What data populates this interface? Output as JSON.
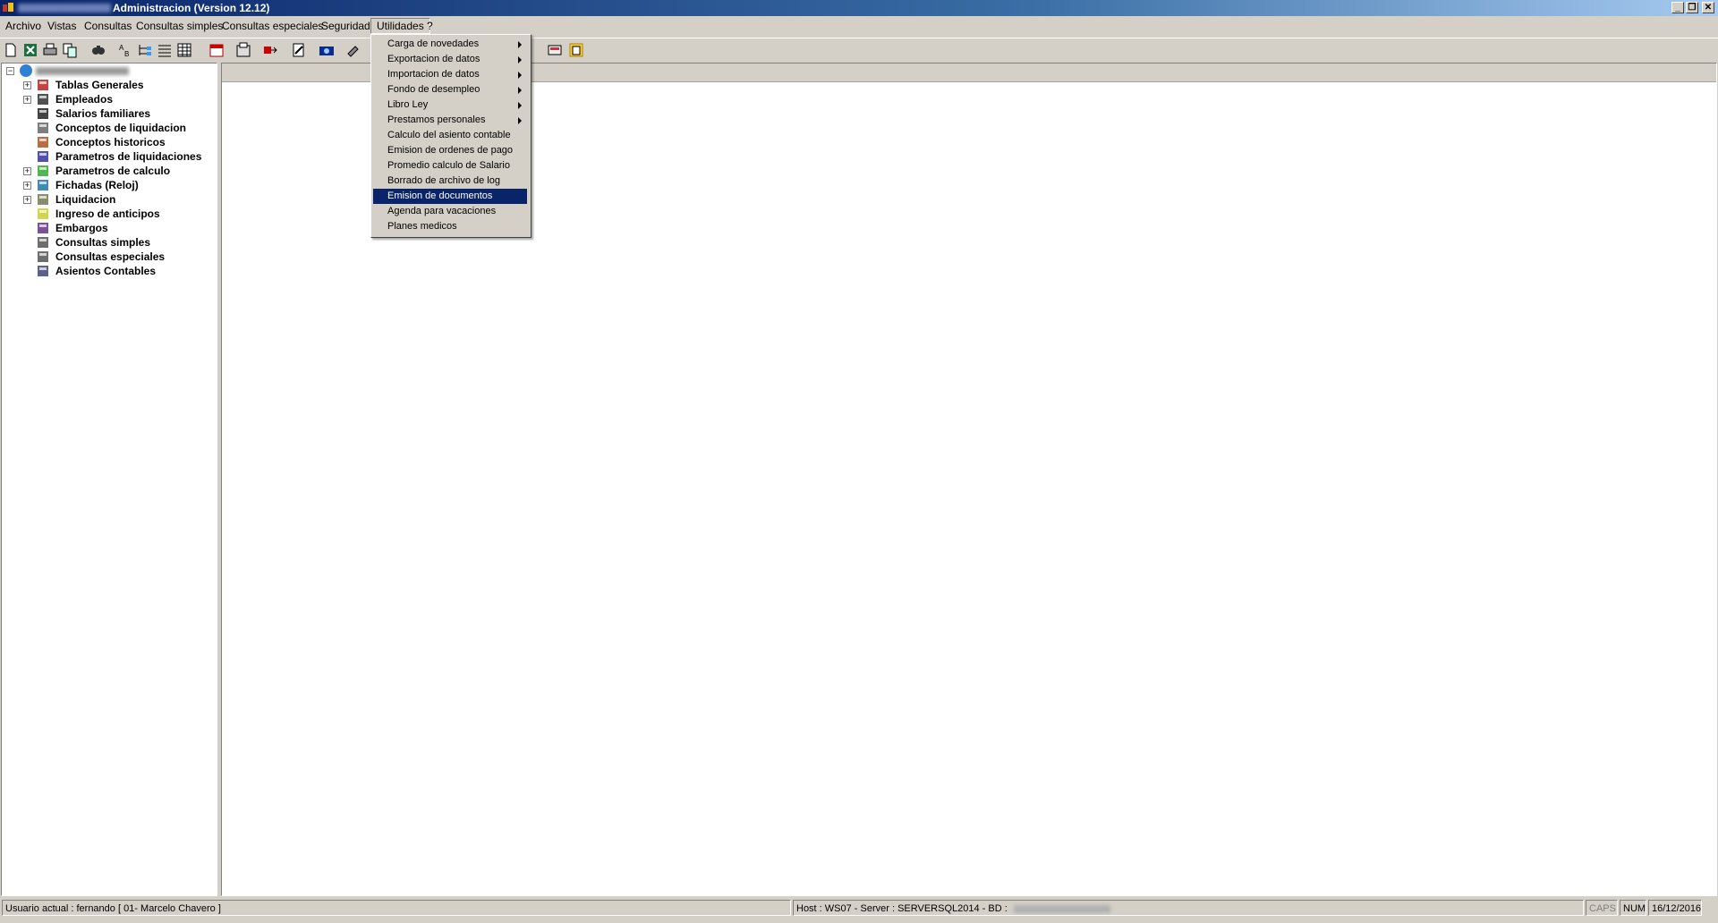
{
  "window": {
    "title": "Administracion (Version 12.12)"
  },
  "menubar": [
    {
      "label": "Archivo"
    },
    {
      "label": "Vistas"
    },
    {
      "label": "Consultas"
    },
    {
      "label": "Consultas simples"
    },
    {
      "label": "Consultas especiales"
    },
    {
      "label": "Seguridad"
    },
    {
      "label": "Utilidades"
    },
    {
      "label": "?"
    }
  ],
  "toolbar_icons": [
    "new-file-icon",
    "excel-icon",
    "print-icon",
    "copy-icon",
    "find-icon",
    "sort-icon",
    "tree-icon",
    "list-icon",
    "grid-icon",
    "calendar-icon",
    "properties-icon",
    "export-icon",
    "edit-icon",
    "cash-icon",
    "tools-icon",
    "report-icon",
    "folder-icon"
  ],
  "tree": {
    "items": [
      {
        "label": "Tablas Generales",
        "expandable": true,
        "icon": "tables-icon"
      },
      {
        "label": "Empleados",
        "expandable": true,
        "icon": "employees-icon"
      },
      {
        "label": "Salarios familiares",
        "expandable": false,
        "icon": "family-icon"
      },
      {
        "label": "Conceptos de liquidacion",
        "expandable": false,
        "icon": "concepts-icon"
      },
      {
        "label": "Conceptos historicos",
        "expandable": false,
        "icon": "history-icon"
      },
      {
        "label": "Parametros de liquidaciones",
        "expandable": false,
        "icon": "params-icon"
      },
      {
        "label": "Parametros de calculo",
        "expandable": true,
        "icon": "calc-icon"
      },
      {
        "label": "Fichadas (Reloj)",
        "expandable": true,
        "icon": "clock-icon"
      },
      {
        "label": "Liquidacion",
        "expandable": true,
        "icon": "payroll-icon"
      },
      {
        "label": "Ingreso de anticipos",
        "expandable": false,
        "icon": "advance-icon"
      },
      {
        "label": "Embargos",
        "expandable": false,
        "icon": "seizure-icon"
      },
      {
        "label": "Consultas simples",
        "expandable": false,
        "icon": "query-icon"
      },
      {
        "label": "Consultas especiales",
        "expandable": false,
        "icon": "query-special-icon"
      },
      {
        "label": "Asientos Contables",
        "expandable": false,
        "icon": "accounting-icon"
      }
    ]
  },
  "dropdown": {
    "items": [
      {
        "label": "Carga de novedades",
        "submenu": true,
        "selected": false
      },
      {
        "label": "Exportacion de datos",
        "submenu": true,
        "selected": false
      },
      {
        "label": "Importacion de datos",
        "submenu": true,
        "selected": false
      },
      {
        "label": "Fondo de desempleo",
        "submenu": true,
        "selected": false
      },
      {
        "label": "Libro Ley",
        "submenu": true,
        "selected": false
      },
      {
        "label": "Prestamos personales",
        "submenu": true,
        "selected": false
      },
      {
        "label": "Calculo del asiento contable",
        "submenu": false,
        "selected": false
      },
      {
        "label": "Emision de ordenes de pago",
        "submenu": false,
        "selected": false
      },
      {
        "label": "Promedio calculo de Salario",
        "submenu": false,
        "selected": false
      },
      {
        "label": "Borrado de archivo de log",
        "submenu": false,
        "selected": false
      },
      {
        "label": "Emision de documentos",
        "submenu": false,
        "selected": true
      },
      {
        "label": "Agenda para vacaciones",
        "submenu": false,
        "selected": false
      },
      {
        "label": "Planes medicos",
        "submenu": false,
        "selected": false
      }
    ]
  },
  "statusbar": {
    "user": "Usuario actual : fernando [ 01- Marcelo Chavero ]",
    "host": "Host : WS07 - Server : SERVERSQL2014 - BD :",
    "caps": "CAPS",
    "num": "NUM",
    "date": "16/12/2016"
  },
  "colors": {
    "title_start": "#0a246a",
    "title_end": "#a6caf0",
    "selection": "#0a246a",
    "face": "#d4d0c8"
  }
}
